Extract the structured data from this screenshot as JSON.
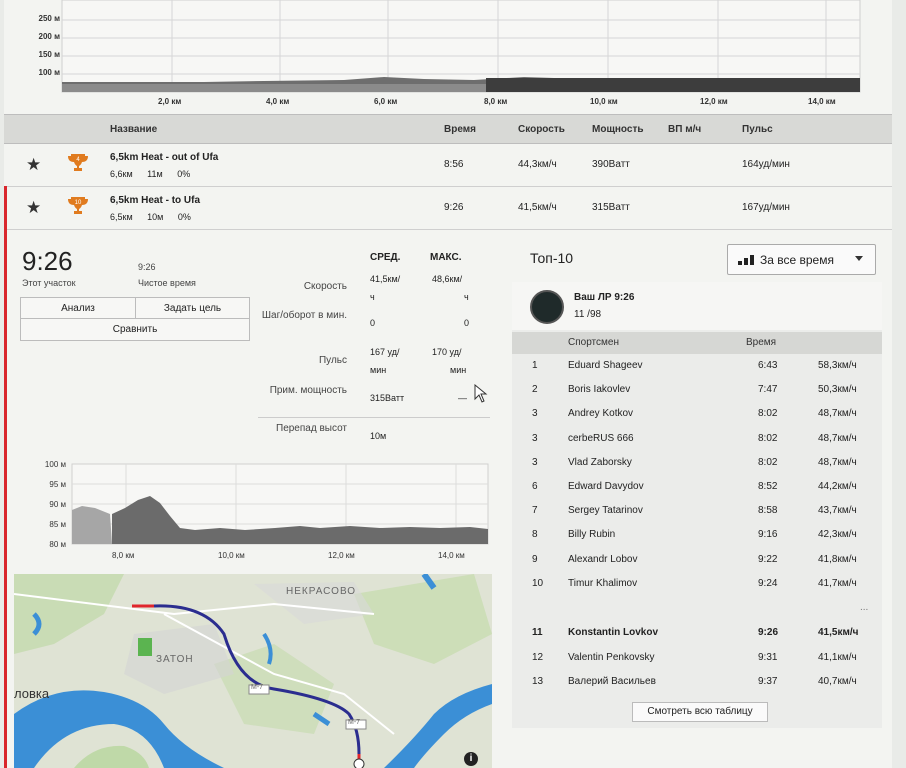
{
  "top_chart": {
    "y_ticks": [
      "250 м",
      "200 м",
      "150 м",
      "100 м"
    ],
    "x_ticks": [
      "2,0 км",
      "4,0 км",
      "6,0 км",
      "8,0 км",
      "10,0 км",
      "12,0 км",
      "14,0 км"
    ]
  },
  "segments_table": {
    "headers": {
      "name": "Название",
      "time": "Время",
      "speed": "Скорость",
      "power": "Мощность",
      "vam": "ВП м/ч",
      "hr": "Пульс"
    },
    "rows": [
      {
        "rank_badge": "4",
        "name": "6,5km Heat - out of Ufa",
        "distance": "6,6км",
        "elev": "11м",
        "grade": "0%",
        "time": "8:56",
        "speed": "44,3км/ч",
        "power": "390Ватт",
        "hr": "164уд/мин"
      },
      {
        "rank_badge": "10",
        "name": "6,5km Heat - to Ufa",
        "distance": "6,5км",
        "elev": "10м",
        "grade": "0%",
        "time": "9:26",
        "speed": "41,5км/ч",
        "power": "315Ватт",
        "hr": "167уд/мин"
      }
    ]
  },
  "detail": {
    "big_time": "9:26",
    "big_time_label": "Этот участок",
    "moving_time": "9:26",
    "moving_time_label": "Чистое время",
    "buttons": {
      "analysis": "Анализ",
      "set_goal": "Задать цель",
      "compare": "Сравнить"
    },
    "stats_headers": {
      "avg": "СРЕД.",
      "max": "МАКС."
    },
    "stats": [
      {
        "label": "Скорость",
        "avg_line1": "41,5км/",
        "avg_line2": "ч",
        "max_line1": "48,6км/",
        "max_line2": "ч"
      },
      {
        "label": "Шаг/оборот в мин.",
        "avg_line1": "0",
        "avg_line2": "",
        "max_line1": "0",
        "max_line2": ""
      },
      {
        "label": "Пульс",
        "avg_line1": "167 уд/",
        "avg_line2": "мин",
        "max_line1": "170 уд/",
        "max_line2": "мин"
      },
      {
        "label": "Прим. мощность",
        "avg_line1": "315Ватт",
        "avg_line2": "",
        "max_line1": "—",
        "max_line2": ""
      },
      {
        "label": "Перепад высот",
        "avg_line1": "10м",
        "avg_line2": "",
        "max_line1": "",
        "max_line2": ""
      }
    ]
  },
  "mini_chart": {
    "y_ticks": [
      "100 м",
      "95 м",
      "90 м",
      "85 м",
      "80 м"
    ],
    "x_ticks": [
      "8,0 км",
      "10,0 км",
      "12,0 км",
      "14,0 км"
    ]
  },
  "map": {
    "labels": {
      "nekrasovo": "НЕКРАСОВО",
      "zaton": "ЗАТОН",
      "lovka": "ловка",
      "road1": "М-7",
      "road2": "М-7"
    },
    "info": "i"
  },
  "top10": {
    "title": "Топ-10",
    "period": "За все время",
    "pr_title": "Ваш ЛР 9:26",
    "pr_rank": "11 /98",
    "col_athlete": "Спортсмен",
    "col_time": "Время",
    "rows": [
      {
        "rank": "1",
        "name": "Eduard Shageev",
        "time": "6:43",
        "speed": "58,3км/ч"
      },
      {
        "rank": "2",
        "name": "Boris Iakovlev",
        "time": "7:47",
        "speed": "50,3км/ч"
      },
      {
        "rank": "3",
        "name": "Andrey Kotkov",
        "time": "8:02",
        "speed": "48,7км/ч"
      },
      {
        "rank": "3",
        "name": "cerbeRUS 666",
        "time": "8:02",
        "speed": "48,7км/ч"
      },
      {
        "rank": "3",
        "name": "Vlad Zaborsky",
        "time": "8:02",
        "speed": "48,7км/ч"
      },
      {
        "rank": "6",
        "name": "Edward Davydov",
        "time": "8:52",
        "speed": "44,2км/ч"
      },
      {
        "rank": "7",
        "name": "Sergey Tatarinov",
        "time": "8:58",
        "speed": "43,7км/ч"
      },
      {
        "rank": "8",
        "name": "Billy Rubin",
        "time": "9:16",
        "speed": "42,3км/ч"
      },
      {
        "rank": "9",
        "name": "Alexandr Lobov",
        "time": "9:22",
        "speed": "41,8км/ч"
      },
      {
        "rank": "10",
        "name": "Timur Khalimov",
        "time": "9:24",
        "speed": "41,7км/ч"
      }
    ],
    "ellipsis": "...",
    "nearby": [
      {
        "rank": "11",
        "name": "Konstantin Lovkov",
        "time": "9:26",
        "speed": "41,5км/ч",
        "me": true
      },
      {
        "rank": "12",
        "name": "Valentin Penkovsky",
        "time": "9:31",
        "speed": "41,1км/ч",
        "me": false
      },
      {
        "rank": "13",
        "name": "Валерий Васильев",
        "time": "9:37",
        "speed": "40,7км/ч",
        "me": false
      }
    ],
    "show_all": "Смотреть всю таблицу"
  },
  "colors": {
    "accent_red": "#d9262c",
    "trophy": "#e07b1f",
    "route_blue": "#2b2d8f",
    "water": "#3b8fd6"
  }
}
